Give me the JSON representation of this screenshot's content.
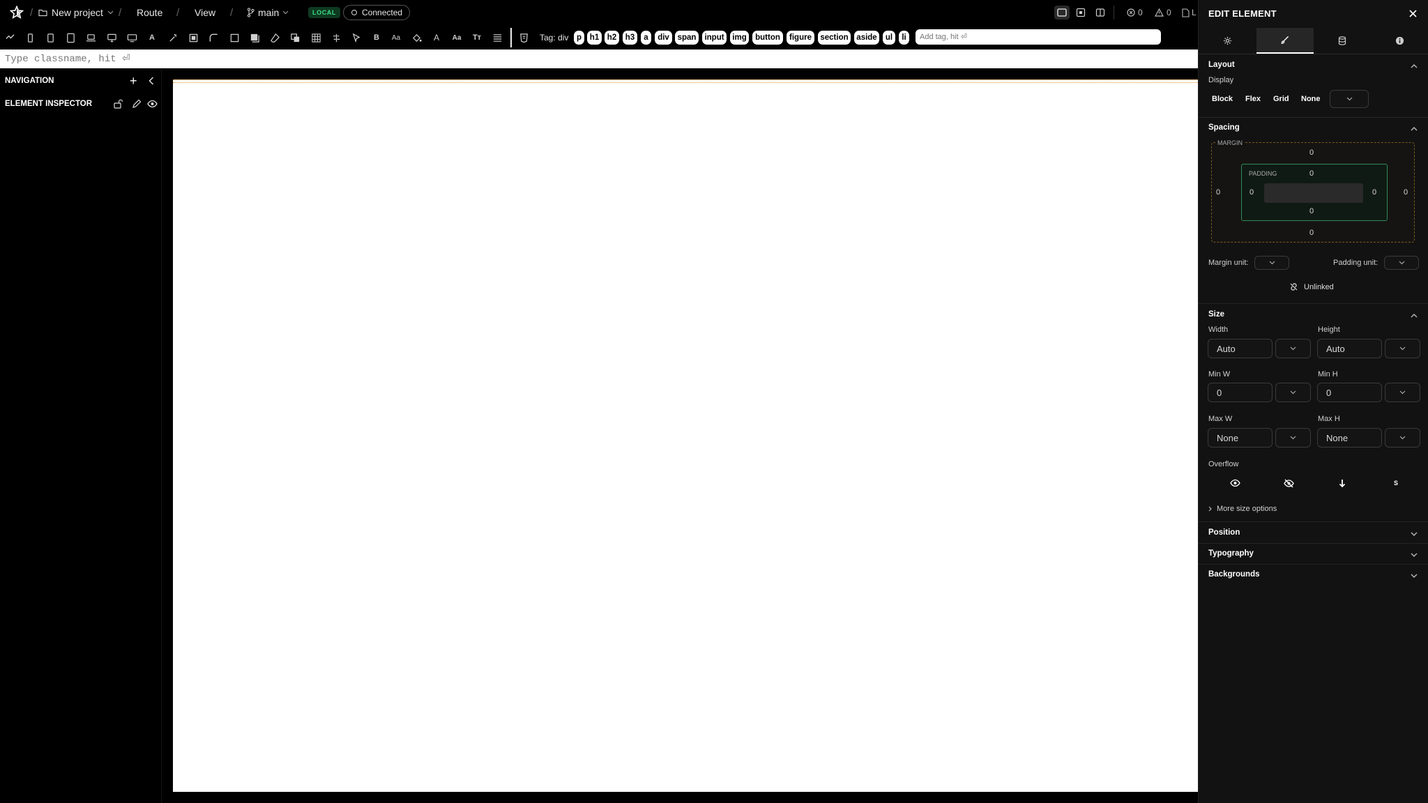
{
  "topbar": {
    "project": "New project",
    "route": "Route",
    "view": "View",
    "branch": "main",
    "env_badge": "LOCAL",
    "connection": "Connected",
    "errors_count": "0",
    "warnings_count": "0",
    "truncated_label": "L"
  },
  "tagbar": {
    "label": "Tag: div",
    "tags": [
      "p",
      "h1",
      "h2",
      "h3",
      "a",
      "div",
      "span",
      "input",
      "img",
      "button",
      "figure",
      "section",
      "aside",
      "ul",
      "li"
    ],
    "placeholder": "Add tag, hit ⏎"
  },
  "classbar": {
    "placeholder": "Type classname, hit ⏎"
  },
  "left_panel": {
    "navigation_title": "NAVIGATION",
    "inspector_title": "ELEMENT INSPECTOR"
  },
  "edit_panel": {
    "title": "EDIT ELEMENT",
    "layout": {
      "title": "Layout",
      "display_label": "Display",
      "options": [
        "Block",
        "Flex",
        "Grid",
        "None"
      ]
    },
    "spacing": {
      "title": "Spacing",
      "margin_label": "MARGIN",
      "padding_label": "PADDING",
      "margin": {
        "top": "0",
        "right": "0",
        "bottom": "0",
        "left": "0"
      },
      "padding": {
        "top": "0",
        "right": "0",
        "bottom": "0",
        "left": "0"
      },
      "margin_unit_label": "Margin unit:",
      "padding_unit_label": "Padding unit:",
      "link_state": "Unlinked"
    },
    "size": {
      "title": "Size",
      "width_label": "Width",
      "width_value": "Auto",
      "height_label": "Height",
      "height_value": "Auto",
      "min_w_label": "Min W",
      "min_w_value": "0",
      "min_h_label": "Min H",
      "min_h_value": "0",
      "max_w_label": "Max W",
      "max_w_value": "None",
      "max_h_label": "Max H",
      "max_h_value": "None",
      "overflow_label": "Overflow",
      "overflow_icons": [
        "eye-icon",
        "eye-off-icon",
        "arrow-down-icon",
        "scroll-s-icon"
      ],
      "overflow_s": "S",
      "more": "More size options"
    },
    "collapsed_sections": [
      "Position",
      "Typography",
      "Backgrounds"
    ]
  }
}
